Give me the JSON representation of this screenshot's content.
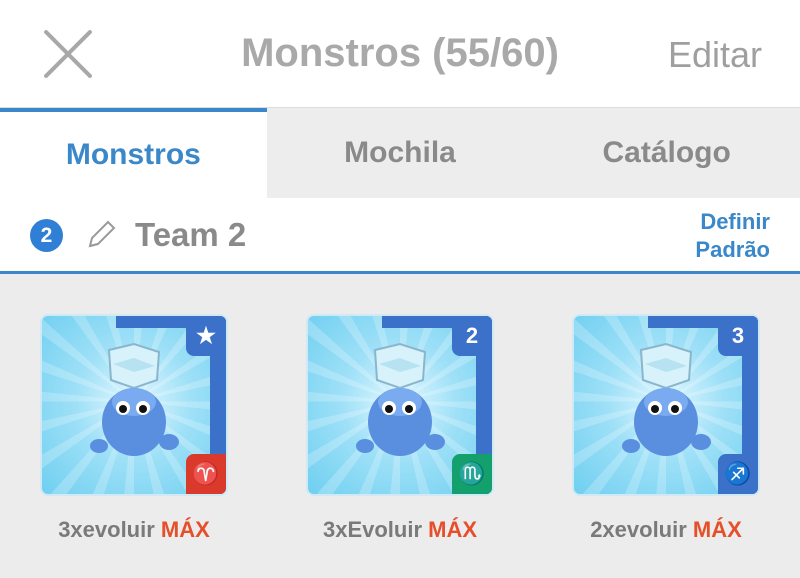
{
  "header": {
    "title": "Monstros (55/60)",
    "edit_label": "Editar",
    "close_icon": "close-icon"
  },
  "tabs": [
    {
      "label": "Monstros",
      "active": true
    },
    {
      "label": "Mochila",
      "active": false
    },
    {
      "label": "Catálogo",
      "active": false
    }
  ],
  "team": {
    "number": "2",
    "name": "Team 2",
    "set_default_line1": "Definir",
    "set_default_line2": "Padrão",
    "edit_icon": "pencil-icon"
  },
  "monsters": [
    {
      "name": "3xevoluir",
      "max_label": "MÁX",
      "top_badge": "★",
      "bottom_badge": "♈",
      "bottom_color": "#d93a2c"
    },
    {
      "name": "3xEvoluir",
      "max_label": "MÁX",
      "top_badge": "2",
      "bottom_badge": "♏",
      "bottom_color": "#13a06d"
    },
    {
      "name": "2xevoluir",
      "max_label": "MÁX",
      "top_badge": "3",
      "bottom_badge": "♐",
      "bottom_color": "#3c71c9"
    }
  ],
  "colors": {
    "accent": "#3a88c9",
    "max": "#e5502a"
  }
}
